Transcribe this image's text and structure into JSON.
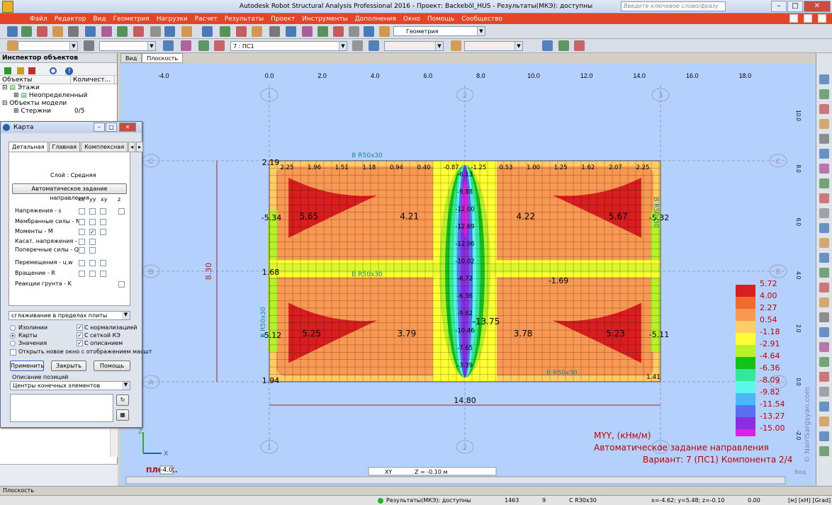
{
  "window": {
    "title": "Autodesk Robot Structural Analysis Professional 2016 - Проект: Backeböl_HUS - Результаты(МКЭ): доступны",
    "search_placeholder": "Введите ключевое слово/фразу"
  },
  "menu": [
    "Файл",
    "Редактор",
    "Вид",
    "Геометрия",
    "Нагрузки",
    "Расчет",
    "Результаты",
    "Проект",
    "Инструменты",
    "Дополнения",
    "Окно",
    "Помощь",
    "Сообщество"
  ],
  "toolbar": {
    "view_combo": "Геометрия",
    "case_combo": "7 : ПС1"
  },
  "inspector": {
    "title": "Инспектор объектов",
    "col_objects": "Объекты",
    "col_count": "Количест...",
    "tree": [
      {
        "label": "Этажи",
        "count": ""
      },
      {
        "label": "Неопределенный",
        "count": ""
      },
      {
        "label": "Объекты модели",
        "count": ""
      },
      {
        "label": "Стержни",
        "count": "0/5"
      }
    ]
  },
  "map_dialog": {
    "title": "Карта",
    "tabs": [
      "Детальная",
      "Главная",
      "Комплексная"
    ],
    "layer_label": "Слой : Средняя",
    "auto_direction_btn": "Автоматическое задание направления",
    "col_headers": [
      "xx",
      "yy",
      "xy",
      "z"
    ],
    "rows": [
      {
        "label": "Напряжения - s",
        "checked": [
          false,
          false,
          false,
          false
        ]
      },
      {
        "label": "Мембранные силы - N",
        "checked": [
          false,
          false,
          false
        ]
      },
      {
        "label": "Моменты - M",
        "checked": [
          false,
          true,
          false
        ]
      },
      {
        "label": "Касат. напряжения - t",
        "checked": [
          false,
          false
        ]
      },
      {
        "label": "Поперечные силы - Q",
        "checked": [
          false,
          false
        ]
      },
      {
        "label": "Перемещения - u,w",
        "checked": [
          false,
          false,
          false
        ]
      },
      {
        "label": "Вращение - R",
        "checked": [
          false,
          false,
          false
        ]
      },
      {
        "label": "Реакции грунта - K",
        "checked": [
          false
        ]
      }
    ],
    "smoothing": "сглаживание в пределах плиты",
    "radio_isolines": "Изолинии",
    "radio_maps": "Карты",
    "radio_values": "Значения",
    "chk_normalize": "С нормализацией",
    "chk_fe_grid": "С сеткой КЭ",
    "chk_description": "С описанием",
    "chk_new_window": "Открыть новое окно с отображением масшт",
    "btn_apply": "Применить",
    "btn_close": "Закрыть",
    "btn_help": "Помощь",
    "positions_label": "Описание позиций",
    "positions_combo": "Центры конечных элементов"
  },
  "view": {
    "tabs": [
      "Вид",
      "Плоскость"
    ],
    "x_ticks": [
      "-4.0",
      "0.0",
      "2.0",
      "4.0",
      "6.0",
      "8.0",
      "10.0",
      "12.0",
      "14.0",
      "16.0",
      "18.0"
    ],
    "y_ticks": [
      "10.0",
      "8.0",
      "6.0",
      "4.0",
      "2.0",
      "0.0",
      "-2.0"
    ],
    "axes_x": [
      "1",
      "2",
      "3"
    ],
    "axes_y": [
      "C",
      "B",
      "A"
    ],
    "beam_labels": [
      "B R50x30",
      "B R50x30",
      "B R50x30",
      "B R50x30",
      "B R50x30"
    ],
    "dim_h": "14.80",
    "dim_v": "8.30",
    "corner_values": {
      "tl": "2.19",
      "ml": "1.68",
      "bl": "1.94",
      "br": "1.41",
      "l1": "-5.34",
      "l2": "-5.12",
      "r1": "-5.32",
      "r2": "-5.11",
      "c1": "-1.69"
    },
    "values": {
      "row1": [
        "2.25",
        "1.96",
        "1.51",
        "1.18",
        "0.94",
        "0.40",
        "-0.87",
        "-1.25",
        "0.53",
        "1.00",
        "1.25",
        "1.62",
        "2.07",
        "2.25"
      ],
      "big": [
        "5.65",
        "4.21",
        "4.22",
        "5.67",
        "5.25",
        "3.79",
        "3.78",
        "5.23",
        "-13.75"
      ],
      "center_col": [
        "-6.13",
        "-9.88",
        "-12.00",
        "-12.69",
        "-12.06",
        "-10.02",
        "-6.72",
        "-6.56",
        "-9.62",
        "-10.46",
        "-7.65",
        "-3.39"
      ]
    },
    "legend_values": [
      "5.72",
      "4.00",
      "2.27",
      "0.54",
      "-1.18",
      "-2.91",
      "-4.64",
      "-6.36",
      "-8.09",
      "-9.82",
      "-11.54",
      "-13.27",
      "-15.00"
    ],
    "legend_colors": [
      "#d81e1e",
      "#f26b2e",
      "#f99852",
      "#ffcc66",
      "#ffff33",
      "#b8f02a",
      "#12c21a",
      "#34e89a",
      "#5cf8f0",
      "#4ab8f8",
      "#5a6ef0",
      "#8a2ee0",
      "#e020e0"
    ],
    "info_line1": "MYY, (кНм/м)",
    "info_line2": "Автоматическое задание направления",
    "info_line3": "Вариант: 7 (ПС1) Компонента 2/4",
    "plan_label": "ПЛОСК.",
    "plan_value": "-4.0",
    "plane_xy": "XY",
    "plane_z": "Z = -0.10 м",
    "view_label": "Вид",
    "watermark": "© NairiSargsyan.com",
    "axis_x": "X",
    "axis_z": "Z"
  },
  "status": {
    "plane": "Плоскость",
    "results": "Результаты(МКЭ): доступны",
    "num1": "1463",
    "num2": "9",
    "section": "C R30x30",
    "coords": "x=-4.62; y=5.48; z=-0.10",
    "zero": "0.00",
    "units": "[м] [кН] [Grad]"
  }
}
